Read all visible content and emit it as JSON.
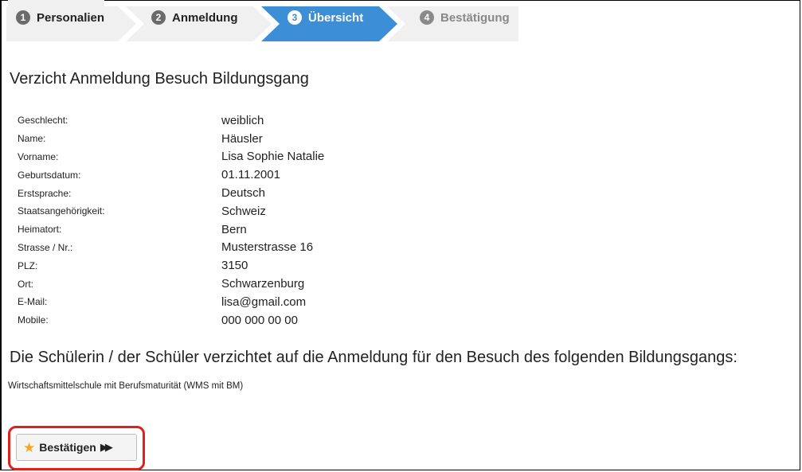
{
  "steps": [
    {
      "number": "1",
      "label": "Personalien",
      "state": "done"
    },
    {
      "number": "2",
      "label": "Anmeldung",
      "state": "done"
    },
    {
      "number": "3",
      "label": "Übersicht",
      "state": "active"
    },
    {
      "number": "4",
      "label": "Bestätigung",
      "state": "todo"
    }
  ],
  "page_title": "Verzicht Anmeldung Besuch Bildungsgang",
  "fields": [
    {
      "label": "Geschlecht:",
      "value": "weiblich"
    },
    {
      "label": "Name:",
      "value": "Häusler"
    },
    {
      "label": "Vorname:",
      "value": "Lisa Sophie Natalie"
    },
    {
      "label": "Geburtsdatum:",
      "value": "01.11.2001"
    },
    {
      "label": "Erstsprache:",
      "value": "Deutsch"
    },
    {
      "label": "Staatsangehörigkeit:",
      "value": "Schweiz"
    },
    {
      "label": "Heimatort:",
      "value": "Bern"
    },
    {
      "label": "Strasse / Nr.:",
      "value": "Musterstrasse 16"
    },
    {
      "label": "PLZ:",
      "value": "3150"
    },
    {
      "label": "Ort:",
      "value": "Schwarzenburg"
    },
    {
      "label": "E-Mail:",
      "value": "lisa@gmail.com"
    },
    {
      "label": "Mobile:",
      "value": "000 000 00 00"
    }
  ],
  "statement": "Die Schülerin / der Schüler verzichtet auf die Anmeldung für den Besuch des folgenden Bildungsgangs:",
  "program": "Wirtschaftsmittelschule mit Berufsmaturität (WMS mit BM)",
  "confirm_button": {
    "label": "Bestätigen",
    "icon": "star-icon",
    "trailing_icon": "fast-forward-icon"
  },
  "colors": {
    "active_step": "#3c8fd6",
    "highlight": "#e0201b",
    "star": "#f5a623"
  }
}
